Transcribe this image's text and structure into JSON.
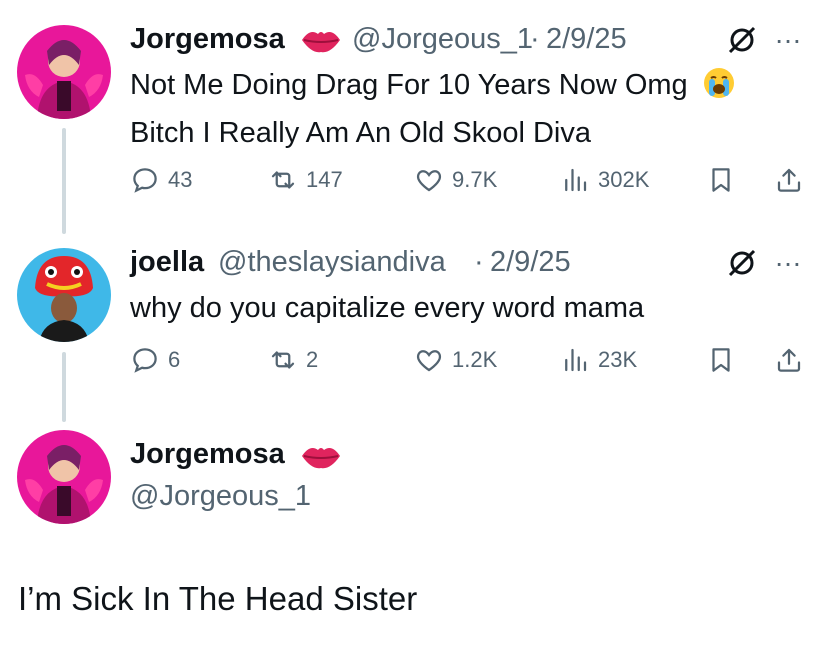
{
  "colors": {
    "text": "#0f1419",
    "secondary": "#536471",
    "line": "#cfd9de",
    "lips": "#e0245e"
  },
  "tweets": [
    {
      "author": "Jorgemosa",
      "author_emoji": "lips-emoji",
      "handle": "@Jorgeous_1",
      "separator": "·",
      "date": "2/9/25",
      "text_line1": "Not Me Doing Drag For 10 Years Now Omg",
      "text_line2": "Bitch I Really Am An Old Skool Diva",
      "emoji": "loudly-crying-face",
      "replies": "43",
      "retweets": "147",
      "likes": "9.7K",
      "views": "302K"
    },
    {
      "author": "joella",
      "handle": "@theslaysiandiva",
      "separator": "·",
      "date": "2/9/25",
      "text_line1": "why do you capitalize every word mama",
      "replies": "6",
      "retweets": "2",
      "likes": "1.2K",
      "views": "23K"
    }
  ],
  "main_tweet": {
    "author": "Jorgemosa",
    "author_emoji": "lips-emoji",
    "handle": "@Jorgeous_1",
    "text": "I’m Sick In The Head Sister"
  },
  "more_icon": "…"
}
